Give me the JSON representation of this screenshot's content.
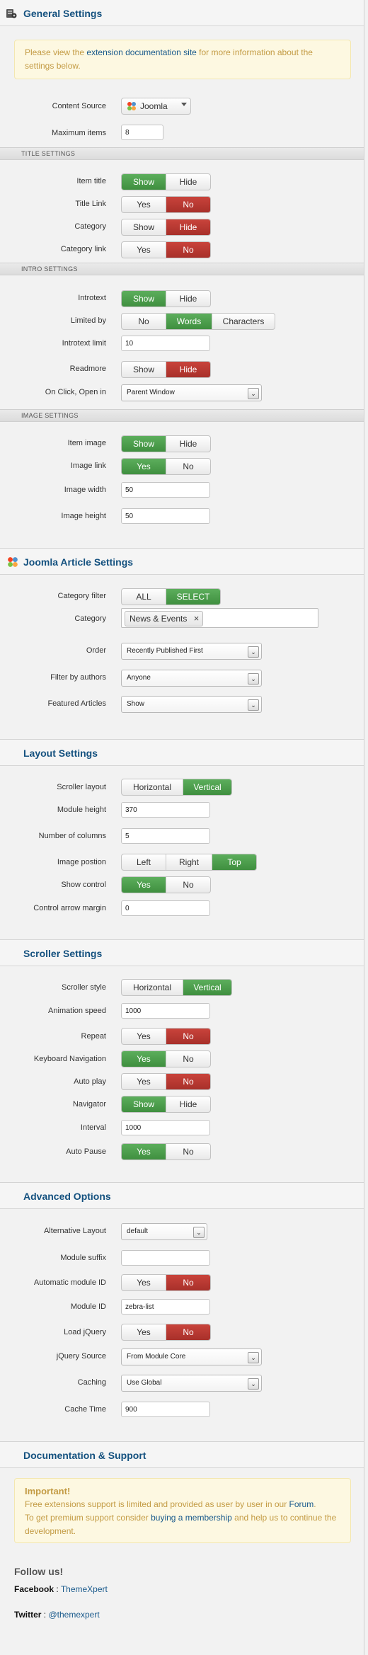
{
  "general": {
    "title": "General Settings",
    "notice_pre": "Please view the ",
    "notice_link": "extension documentation site",
    "notice_post": " for more information about the settings below.",
    "content_source_label": "Content Source",
    "content_source_value": "Joomla",
    "max_items_label": "Maximum items",
    "max_items_value": "8"
  },
  "title_settings": {
    "header": "TITLE SETTINGS",
    "item_title": {
      "label": "Item title",
      "a": "Show",
      "b": "Hide",
      "active": "a"
    },
    "title_link": {
      "label": "Title Link",
      "a": "Yes",
      "b": "No",
      "active": "b"
    },
    "category": {
      "label": "Category",
      "a": "Show",
      "b": "Hide",
      "active": "b"
    },
    "category_link": {
      "label": "Category link",
      "a": "Yes",
      "b": "No",
      "active": "b"
    }
  },
  "intro_settings": {
    "header": "INTRO SETTINGS",
    "introtext": {
      "label": "Introtext",
      "a": "Show",
      "b": "Hide"
    },
    "limited_by": {
      "label": "Limited by",
      "a": "No",
      "b": "Words",
      "c": "Characters"
    },
    "introtext_limit_label": "Introtext limit",
    "introtext_limit_value": "10",
    "readmore": {
      "label": "Readmore",
      "a": "Show",
      "b": "Hide"
    },
    "onclick_label": "On Click, Open in",
    "onclick_value": "Parent Window"
  },
  "image_settings": {
    "header": "IMAGE SETTINGS",
    "item_image": {
      "label": "Item image",
      "a": "Show",
      "b": "Hide"
    },
    "image_link": {
      "label": "Image link",
      "a": "Yes",
      "b": "No"
    },
    "image_width_label": "Image width",
    "image_width_value": "50",
    "image_height_label": "Image height",
    "image_height_value": "50"
  },
  "joomla": {
    "title": "Joomla Article Settings",
    "category_filter": {
      "label": "Category filter",
      "a": "ALL",
      "b": "SELECT"
    },
    "category_label": "Category",
    "category_tag": "News & Events",
    "category_tag_remove": "×",
    "order_label": "Order",
    "order_value": "Recently Published First",
    "filter_authors_label": "Filter by authors",
    "filter_authors_value": "Anyone",
    "featured_label": "Featured Articles",
    "featured_value": "Show"
  },
  "layout": {
    "title": "Layout Settings",
    "scroller_layout": {
      "label": "Scroller layout",
      "a": "Horizontal",
      "b": "Vertical"
    },
    "module_height_label": "Module height",
    "module_height_value": "370",
    "columns_label": "Number of columns",
    "columns_value": "5",
    "image_position": {
      "label": "Image postion",
      "a": "Left",
      "b": "Right",
      "c": "Top"
    },
    "show_control": {
      "label": "Show control",
      "a": "Yes",
      "b": "No"
    },
    "arrow_margin_label": "Control arrow margin",
    "arrow_margin_value": "0"
  },
  "scroller": {
    "title": "Scroller Settings",
    "scroller_style": {
      "label": "Scroller style",
      "a": "Horizontal",
      "b": "Vertical"
    },
    "animation_speed_label": "Animation speed",
    "animation_speed_value": "1000",
    "repeat": {
      "label": "Repeat",
      "a": "Yes",
      "b": "No"
    },
    "keyboard": {
      "label": "Keyboard Navigation",
      "a": "Yes",
      "b": "No"
    },
    "autoplay": {
      "label": "Auto play",
      "a": "Yes",
      "b": "No"
    },
    "navigator": {
      "label": "Navigator",
      "a": "Show",
      "b": "Hide"
    },
    "interval_label": "Interval",
    "interval_value": "1000",
    "autopause": {
      "label": "Auto Pause",
      "a": "Yes",
      "b": "No"
    }
  },
  "advanced": {
    "title": "Advanced Options",
    "alt_layout_label": "Alternative Layout",
    "alt_layout_value": "default",
    "suffix_label": "Module suffix",
    "suffix_value": "",
    "auto_id": {
      "label": "Automatic module ID",
      "a": "Yes",
      "b": "No"
    },
    "module_id_label": "Module ID",
    "module_id_value": "zebra-list",
    "load_jquery": {
      "label": "Load jQuery",
      "a": "Yes",
      "b": "No"
    },
    "jquery_source_label": "jQuery Source",
    "jquery_source_value": "From Module Core",
    "caching_label": "Caching",
    "caching_value": "Use Global",
    "cache_time_label": "Cache Time",
    "cache_time_value": "900"
  },
  "docs": {
    "title": "Documentation & Support",
    "important": "Important!",
    "line1_pre": "Free extensions support is limited and provided as user by user in our ",
    "line1_link": "Forum",
    "line1_post": ".",
    "line2_pre": "To get premium support consider ",
    "line2_link": "buying a membership",
    "line2_post": " and help us to continue the development.",
    "follow": "Follow us!",
    "facebook_label": "Facebook",
    "facebook_sep": " : ",
    "facebook_link": "ThemeXpert",
    "twitter_label": "Twitter",
    "twitter_sep": " : ",
    "twitter_link": "@themexpert"
  },
  "dropdown_arrow": "⌄"
}
